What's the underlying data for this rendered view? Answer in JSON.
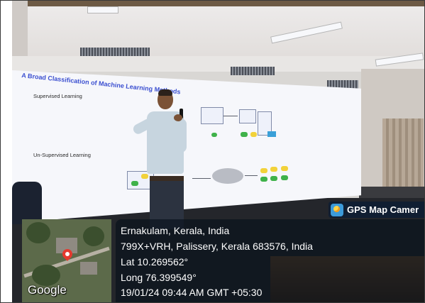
{
  "slide": {
    "title": "A Broad Classification of Machine Learning Methods",
    "supervised_label": "Supervised Learning",
    "unsupervised_label": "Un-Supervised Learning"
  },
  "gps_overlay": {
    "app_name": "GPS Map Camer",
    "app_icon": "gps-map-camera-app-icon",
    "map_logo": "Google",
    "city_line": "Ernakulam, Kerala, India",
    "address_line": "799X+VRH, Palissery, Kerala 683576, India",
    "latitude_line": "Lat 10.269562°",
    "longitude_line": "Long 76.399549°",
    "datetime_line": "19/01/24 09:44 AM GMT +05:30"
  },
  "colors": {
    "slide_title": "#3b4fd0",
    "overlay_panel": "#08101c",
    "map_pin": "#e5392f",
    "shirt": "#c7d5df"
  }
}
